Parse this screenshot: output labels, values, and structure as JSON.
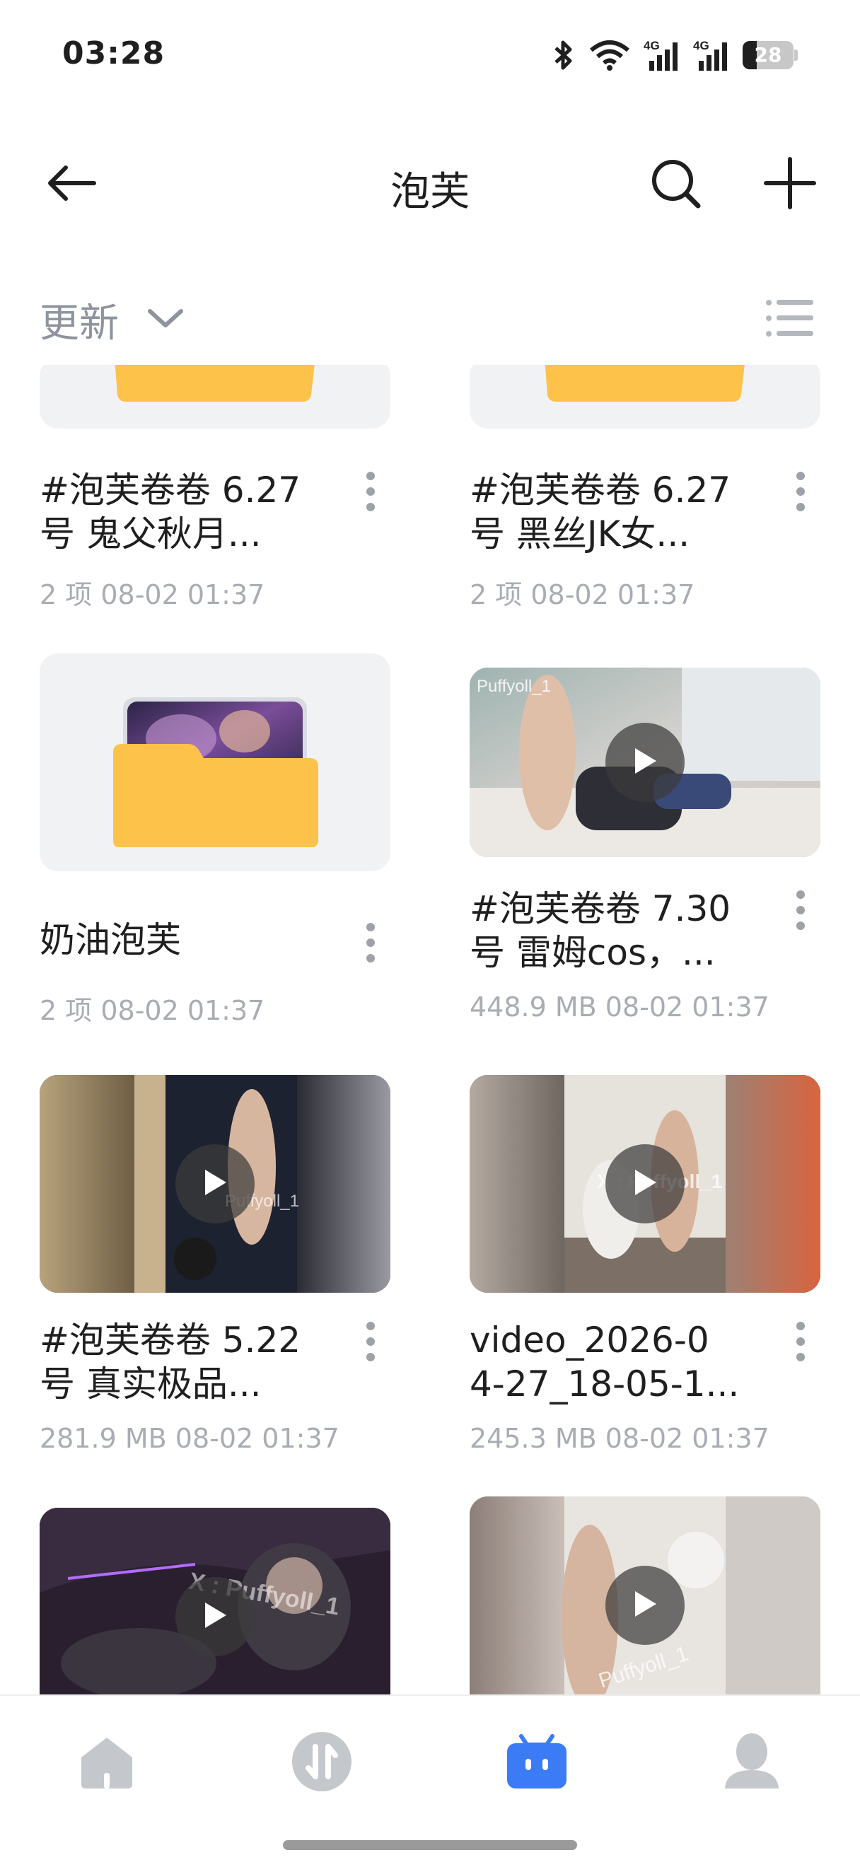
{
  "status_bar": {
    "time": "03:28",
    "battery_level": "28",
    "icons": [
      "bluetooth-icon",
      "wifi-icon",
      "signal-4g-icon",
      "signal-4g-icon",
      "battery-icon"
    ]
  },
  "header": {
    "title": "泡芙",
    "back_icon": "arrow-left-icon",
    "search_icon": "search-icon",
    "add_icon": "plus-icon"
  },
  "sort_bar": {
    "label": "更新",
    "dropdown_icon": "chevron-down-icon",
    "view_icon": "list-view-icon"
  },
  "items": [
    {
      "type": "folder",
      "name": "#泡芙卷卷 6.27\n号 鬼父秋月...",
      "meta": "2 项  08-02 01:37"
    },
    {
      "type": "folder",
      "name": "#泡芙卷卷 6.27\n号 黑丝JK女...",
      "meta": "2 项  08-02 01:37"
    },
    {
      "type": "folder",
      "name": "奶油泡芙",
      "meta": "2 项  08-02 01:37"
    },
    {
      "type": "video",
      "name": "#泡芙卷卷 7.30\n号 雷姆cos，...",
      "meta": "448.9 MB  08-02 01:37",
      "watermark": "Puffyoll_1"
    },
    {
      "type": "video",
      "name": "#泡芙卷卷 5.22\n号 真实极品...",
      "meta": "281.9 MB  08-02 01:37",
      "watermark": "Puffyoll_1"
    },
    {
      "type": "video",
      "name": "video_2026-0\n4-27_18-05-1...",
      "meta": "245.3 MB  08-02 01:37",
      "watermark": "X : Puffyoll_1"
    },
    {
      "type": "video",
      "name": "",
      "meta": "",
      "watermark": "X : Puffyoll_1"
    },
    {
      "type": "video",
      "name": "",
      "meta": "",
      "watermark": "Puffyoll_1"
    }
  ],
  "bottom_nav": {
    "items": [
      "home-icon",
      "transfer-icon",
      "files-icon",
      "profile-icon"
    ],
    "active": "files-icon",
    "active_color": "#3b7bf6",
    "inactive_color": "#c4c7cc"
  },
  "colors": {
    "folder_yellow": "#fdc24a",
    "card_bg": "#f1f2f4",
    "meta_gray": "#a9adb3"
  }
}
